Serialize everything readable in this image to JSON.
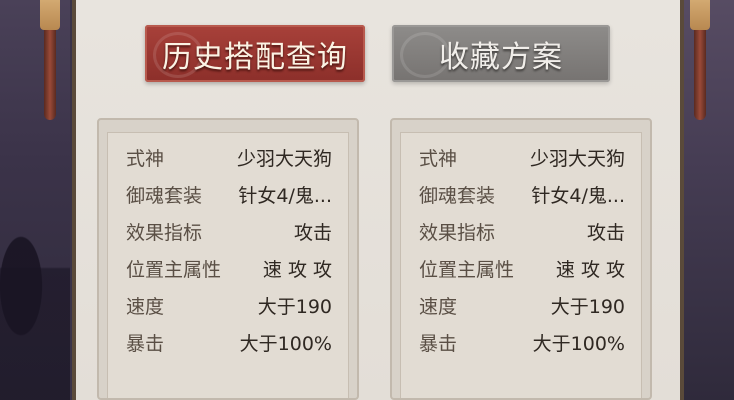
{
  "tabs": [
    {
      "label": "历史搭配查询",
      "active": true
    },
    {
      "label": "收藏方案",
      "active": false
    }
  ],
  "panels": [
    {
      "rows": [
        {
          "label": "式神",
          "value": "少羽大天狗"
        },
        {
          "label": "御魂套装",
          "value": "针女4/鬼..."
        },
        {
          "label": "效果指标",
          "value": "攻击"
        },
        {
          "label": "位置主属性",
          "value": "速 攻 攻"
        },
        {
          "label": "速度",
          "value": "大于190"
        },
        {
          "label": "暴击",
          "value": "大于100%"
        }
      ]
    },
    {
      "rows": [
        {
          "label": "式神",
          "value": "少羽大天狗"
        },
        {
          "label": "御魂套装",
          "value": "针女4/鬼..."
        },
        {
          "label": "效果指标",
          "value": "攻击"
        },
        {
          "label": "位置主属性",
          "value": "速 攻 攻"
        },
        {
          "label": "速度",
          "value": "大于190"
        },
        {
          "label": "暴击",
          "value": "大于100%"
        }
      ]
    }
  ],
  "colors": {
    "active_tab": "#9a3832",
    "inactive_tab": "#828080",
    "panel_bg": "#e2dcd3"
  }
}
